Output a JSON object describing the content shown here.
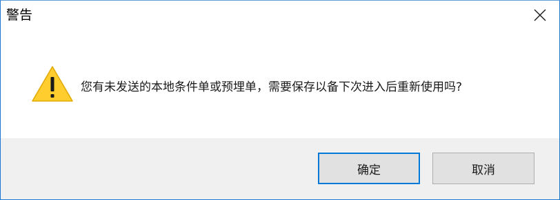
{
  "dialog": {
    "title": "警告",
    "message": "您有未发送的本地条件单或预埋单，需要保存以备下次进入后重新使用吗?",
    "icon": "warning-icon",
    "close_icon": "close-icon"
  },
  "buttons": {
    "ok_label": "确定",
    "cancel_label": "取消"
  },
  "colors": {
    "accent": "#0078d7",
    "warning_fill": "#ffce2e",
    "footer_bg": "#f0f0f0"
  }
}
